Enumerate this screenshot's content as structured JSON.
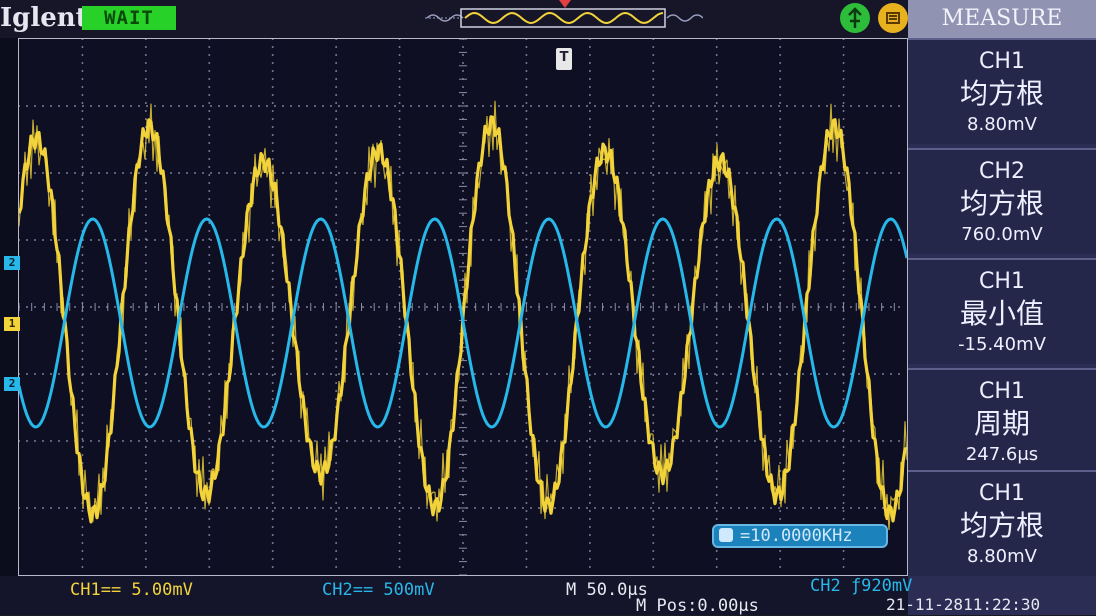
{
  "header": {
    "brand": "Iglent",
    "run_status": "WAIT"
  },
  "waveform": {
    "ch1_color": "#f2d33a",
    "ch2_color": "#27b7e8",
    "channel_markers": [
      "2",
      "1",
      "2"
    ]
  },
  "measure_panel": {
    "title": "MEASURE",
    "items": [
      {
        "channel": "CH1",
        "type": "均方根",
        "value": "8.80mV"
      },
      {
        "channel": "CH2",
        "type": "均方根",
        "value": "760.0mV"
      },
      {
        "channel": "CH1",
        "type": "最小值",
        "value": "-15.40mV"
      },
      {
        "channel": "CH1",
        "type": "周期",
        "value": "247.6μs"
      },
      {
        "channel": "CH1",
        "type": "均方根",
        "value": "8.80mV"
      }
    ]
  },
  "frequency_readout": "=10.0000KHz",
  "status_bar": {
    "ch1_scale": "CH1== 5.00mV",
    "ch2_scale": "CH2== 500mV",
    "timebase": "M 50.0μs",
    "trigger": "CH2 ƒ920mV",
    "m_pos": "M Pos:0.00μs",
    "datetime": "21-11-2811:22:30"
  },
  "icons": {
    "usb_icon": "usb-icon",
    "print_icon": "print-icon"
  },
  "colors": {
    "run_status_bg": "#27d127",
    "panel_title_bg": "#9193b3",
    "panel_bg": "#24264a",
    "ch1": "#f2d33a",
    "ch2": "#27b7e8",
    "trigger_marker": "#e04040"
  }
}
